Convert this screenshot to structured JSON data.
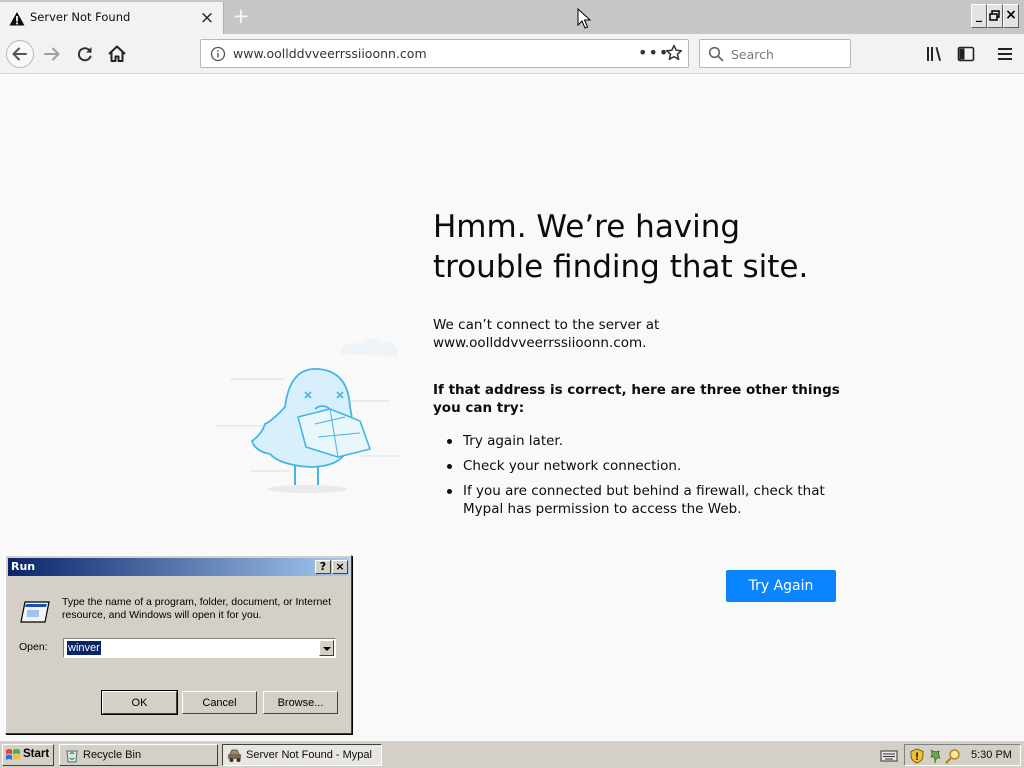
{
  "browser": {
    "tab": {
      "title": "Server Not Found",
      "close_glyph": "×"
    },
    "new_tab_glyph": "+",
    "window_buttons": {
      "minimize": "_",
      "restore": "▫",
      "close": "×"
    },
    "url": "www.oollddvveerrssiioonn.com",
    "page_actions_glyph": "•••",
    "search_placeholder": "Search"
  },
  "error_page": {
    "title": "Hmm. We’re having trouble finding that site.",
    "message": "We can’t connect to the server at www.oollddvveerrssiioonn.com.",
    "subtitle": "If that address is correct, here are three other things you can try:",
    "suggestions": [
      "Try again later.",
      "Check your network connection.",
      "If you are connected but behind a firewall, check that Mypal has permission to access the Web."
    ],
    "try_again_label": "Try Again"
  },
  "run_dialog": {
    "title": "Run",
    "help_glyph": "?",
    "close_glyph": "×",
    "description": "Type the name of a program, folder, document, or Internet resource, and Windows will open it for you.",
    "open_label": "Open:",
    "open_value": "winver",
    "ok_label": "OK",
    "cancel_label": "Cancel",
    "browse_label": "Browse..."
  },
  "taskbar": {
    "start_label": "Start",
    "items": [
      {
        "label": "Recycle Bin",
        "icon": "recycle-bin-icon"
      },
      {
        "label": "Server Not Found - Mypal",
        "icon": "mypal-icon"
      }
    ],
    "clock": "5:30 PM"
  },
  "colors": {
    "accent": "#0a84ff",
    "page_bg": "#f9f9fa",
    "titlebar_start": "#0a246a",
    "titlebar_end": "#a6caf0"
  }
}
